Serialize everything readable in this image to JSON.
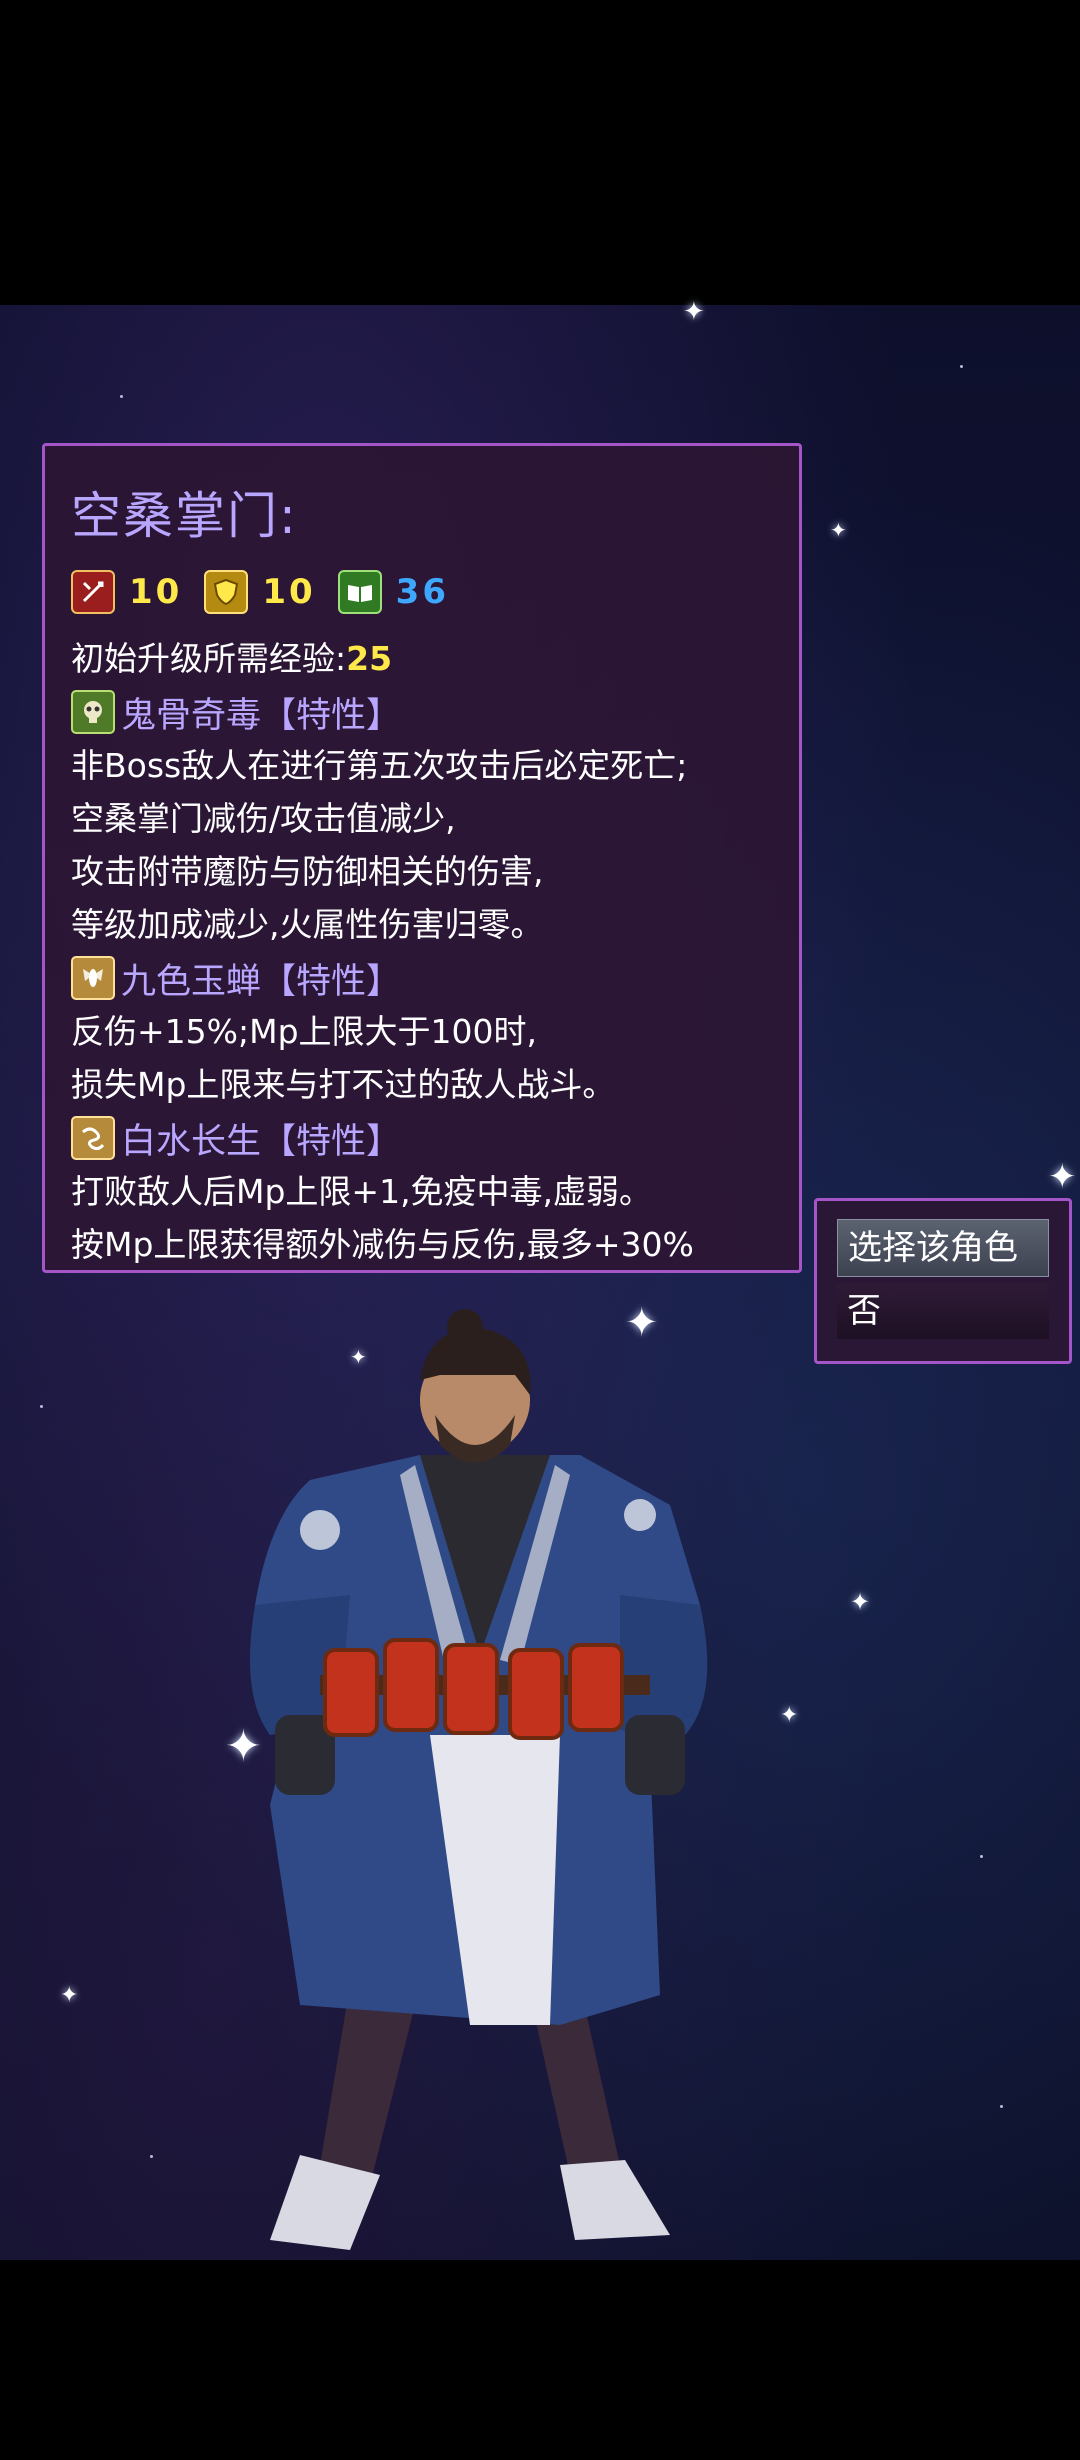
{
  "character": {
    "name": "空桑掌门:",
    "stats": [
      {
        "icon": "attack-icon",
        "value": "10",
        "color": "#ffe94a"
      },
      {
        "icon": "defense-icon",
        "value": "10",
        "color": "#ffe94a"
      },
      {
        "icon": "book-icon",
        "value": "36",
        "color": "#3ea8ff"
      }
    ],
    "exp_label": "初始升级所需经验:",
    "exp_value": "25",
    "traits": [
      {
        "icon": "poison-skull-icon",
        "name": "鬼骨奇毒【特性】",
        "lines": [
          "非Boss敌人在进行第五次攻击后必定死亡;",
          "空桑掌门减伤/攻击值减少,",
          "攻击附带魔防与防御相关的伤害,",
          "等级加成减少,火属性伤害归零。"
        ]
      },
      {
        "icon": "cicada-icon",
        "name": "九色玉蝉【特性】",
        "lines": [
          "反伤+15%;Mp上限大于100时,",
          "损失Mp上限来与打不过的敌人战斗。"
        ]
      },
      {
        "icon": "water-icon",
        "name": "白水长生【特性】",
        "lines": [
          "打败敌人后Mp上限+1,免疫中毒,虚弱。",
          "按Mp上限获得额外减伤与反伤,最多+30%"
        ]
      }
    ]
  },
  "choices": {
    "select_label": "选择该角色",
    "no_label": "否"
  }
}
